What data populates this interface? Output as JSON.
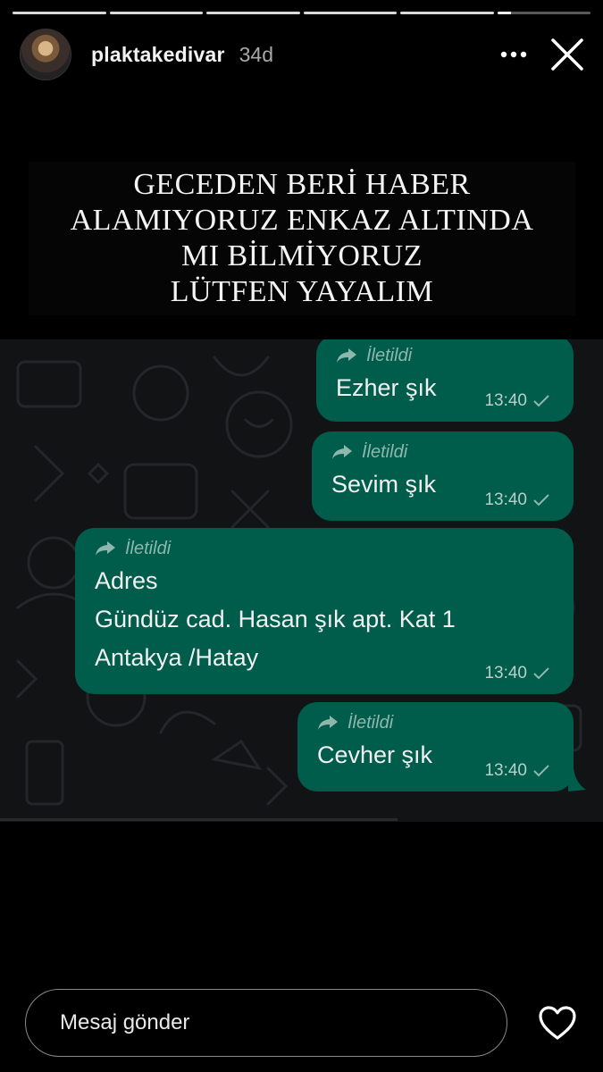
{
  "story": {
    "username": "plaktakedivar",
    "time_ago": "34d",
    "progress_segments": 6,
    "current_segment_progress": 0.15
  },
  "header": {
    "more_icon": "more-horizontal-icon",
    "close_icon": "close-icon"
  },
  "banner": {
    "lines": [
      "GECEDEN BERİ HABER",
      "ALAMIYORUZ ENKAZ ALTINDA",
      "MI BİLMİYORUZ",
      "LÜTFEN YAYALIM"
    ]
  },
  "chat": {
    "forwarded_label": "İletildi",
    "messages": [
      {
        "lines": [
          "Ezher şık"
        ],
        "time": "13:40"
      },
      {
        "lines": [
          "Sevim şık"
        ],
        "time": "13:40"
      },
      {
        "lines": [
          "Adres",
          "Gündüz cad. Hasan şık apt. Kat 1",
          "Antakya /Hatay"
        ],
        "time": "13:40"
      },
      {
        "lines": [
          "Cevher şık"
        ],
        "time": "13:40"
      }
    ],
    "bubble_color": "#005c4b",
    "background_color": "#111314"
  },
  "footer": {
    "message_placeholder": "Mesaj gönder",
    "like_icon": "heart-outline-icon"
  }
}
